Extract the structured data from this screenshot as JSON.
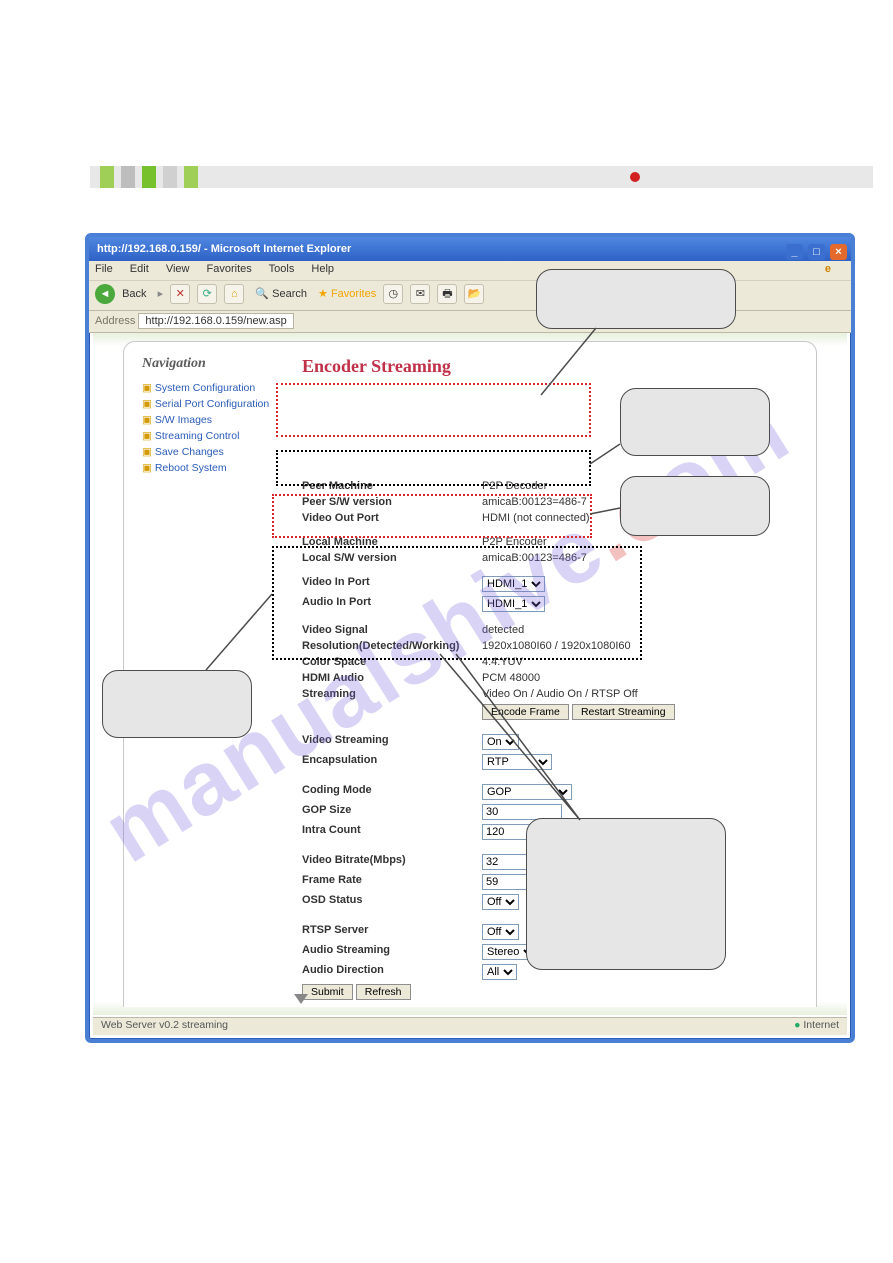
{
  "colors": {
    "accent": "#c03048",
    "link": "#2a5bb8"
  },
  "topbar": {
    "dot_color": "#d02020"
  },
  "window": {
    "title": "http://192.168.0.159/ - Microsoft Internet Explorer",
    "close_icon": "×",
    "min_icon": "_",
    "max_icon": "□"
  },
  "menubar": {
    "items": [
      "File",
      "Edit",
      "View",
      "Favorites",
      "Tools",
      "Help"
    ],
    "logo": "e"
  },
  "toolbar": {
    "back": "Back",
    "fwd": "▸",
    "stop": "✕",
    "refresh": "⟳",
    "home": "⌂",
    "search": "🔍 Search",
    "favorites": "★ Favorites",
    "history": "◷",
    "mail": "✉",
    "print": "🖶",
    "open": "📂"
  },
  "addrbar": {
    "label": "Address",
    "url": "http://192.168.0.159/new.asp"
  },
  "navigation": {
    "header": "Navigation",
    "items": [
      "System Configuration",
      "Serial Port Configuration",
      "S/W Images",
      "Streaming Control",
      "Save Changes",
      "Reboot System"
    ]
  },
  "main": {
    "title": "Encoder Streaming",
    "peer": {
      "machine_label": "Peer Machine",
      "machine_value": "P2P Decoder",
      "sw_label": "Peer S/W version",
      "sw_value": "amicaB:00123=486-7",
      "vout_label": "Video Out Port",
      "vout_value": "HDMI (not connected)"
    },
    "local": {
      "machine_label": "Local Machine",
      "machine_value": "P2P Encoder",
      "sw_label": "Local S/W version",
      "sw_value": "amicaB:00123=486-7"
    },
    "inports": {
      "vin_label": "Video In Port",
      "vin_value": "HDMI_1",
      "ain_label": "Audio In Port",
      "ain_value": "HDMI_1"
    },
    "signal": {
      "vsig_label": "Video Signal",
      "vsig_value": "detected",
      "res_label": "Resolution(Detected/Working)",
      "res_value": "1920x1080I60 / 1920x1080I60",
      "cspace_label": "Color Space",
      "cspace_value": "4:4:YUV",
      "hdmi_audio_label": "HDMI Audio",
      "hdmi_audio_value": "PCM 48000",
      "streaming_label": "Streaming",
      "streaming_value": "Video On / Audio On / RTSP Off",
      "btn_encode": "Encode Frame",
      "btn_restart": "Restart Streaming"
    },
    "settings": {
      "vstream_label": "Video Streaming",
      "vstream_value": "On",
      "encap_label": "Encapsulation",
      "encap_value": "RTP",
      "cmode_label": "Coding Mode",
      "cmode_value": "GOP",
      "gop_label": "GOP Size",
      "gop_value": "30",
      "intra_label": "Intra Count",
      "intra_value": "120",
      "vbr_label": "Video Bitrate(Mbps)",
      "vbr_value": "32",
      "frate_label": "Frame Rate",
      "frate_value": "59",
      "osd_label": "OSD Status",
      "osd_value": "Off",
      "rtsp_label": "RTSP Server",
      "rtsp_value": "Off",
      "astream_label": "Audio Streaming",
      "astream_value": "Stereo",
      "adir_label": "Audio Direction",
      "adir_value": "All",
      "submit": "Submit",
      "refresh": "Refresh"
    }
  },
  "statusbar": {
    "left": "Web Server v0.2 streaming",
    "right": "Internet"
  },
  "watermark": {
    "text_a": "manualshive",
    "text_b": ".c",
    "text_c": "om"
  }
}
